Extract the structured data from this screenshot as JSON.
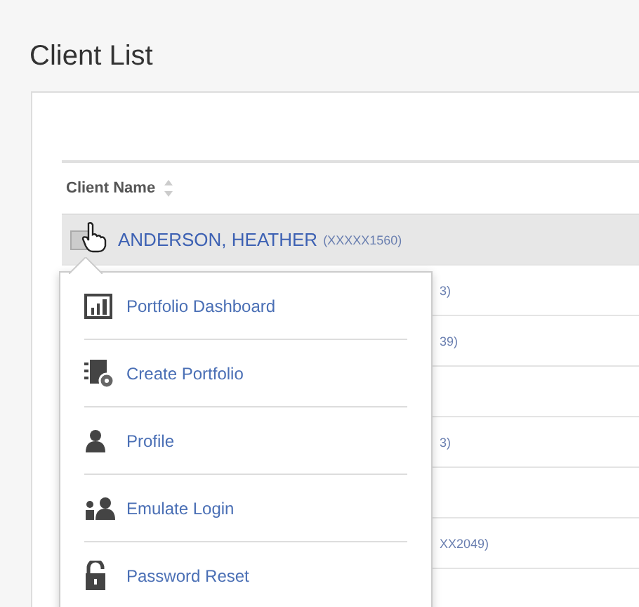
{
  "page": {
    "title": "Client List"
  },
  "table": {
    "columns": [
      {
        "label": "Client Name",
        "sortable": true
      }
    ],
    "rows": [
      {
        "name": "ANDERSON, HEATHER",
        "account": "(XXXXX1560)",
        "selected": true
      },
      {
        "account": "3)",
        "selected": false
      },
      {
        "account": "39)",
        "selected": false
      },
      {
        "selected": false
      },
      {
        "account": "3)",
        "selected": false
      },
      {
        "selected": false
      },
      {
        "account": "XX2049)",
        "selected": false
      }
    ]
  },
  "context_menu": {
    "items": [
      {
        "label": "Portfolio Dashboard",
        "kind": "dashboard"
      },
      {
        "label": "Create Portfolio",
        "kind": "create"
      },
      {
        "label": "Profile",
        "kind": "profile"
      },
      {
        "label": "Emulate Login",
        "kind": "emulate"
      },
      {
        "label": "Password Reset",
        "kind": "lock"
      }
    ]
  }
}
